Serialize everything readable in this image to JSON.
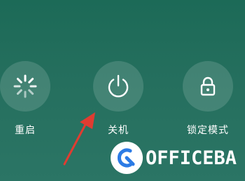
{
  "power_menu": {
    "options": [
      {
        "label": "重启",
        "icon": "restart-spinner-icon"
      },
      {
        "label": "关机",
        "icon": "power-icon"
      },
      {
        "label": "锁定模式",
        "icon": "lock-icon"
      }
    ]
  },
  "annotation": {
    "arrow_color": "#e03c31"
  },
  "watermark": {
    "text": "OFFICEBA",
    "icon": "office-logo-icon",
    "accent": "#2c7be5"
  }
}
